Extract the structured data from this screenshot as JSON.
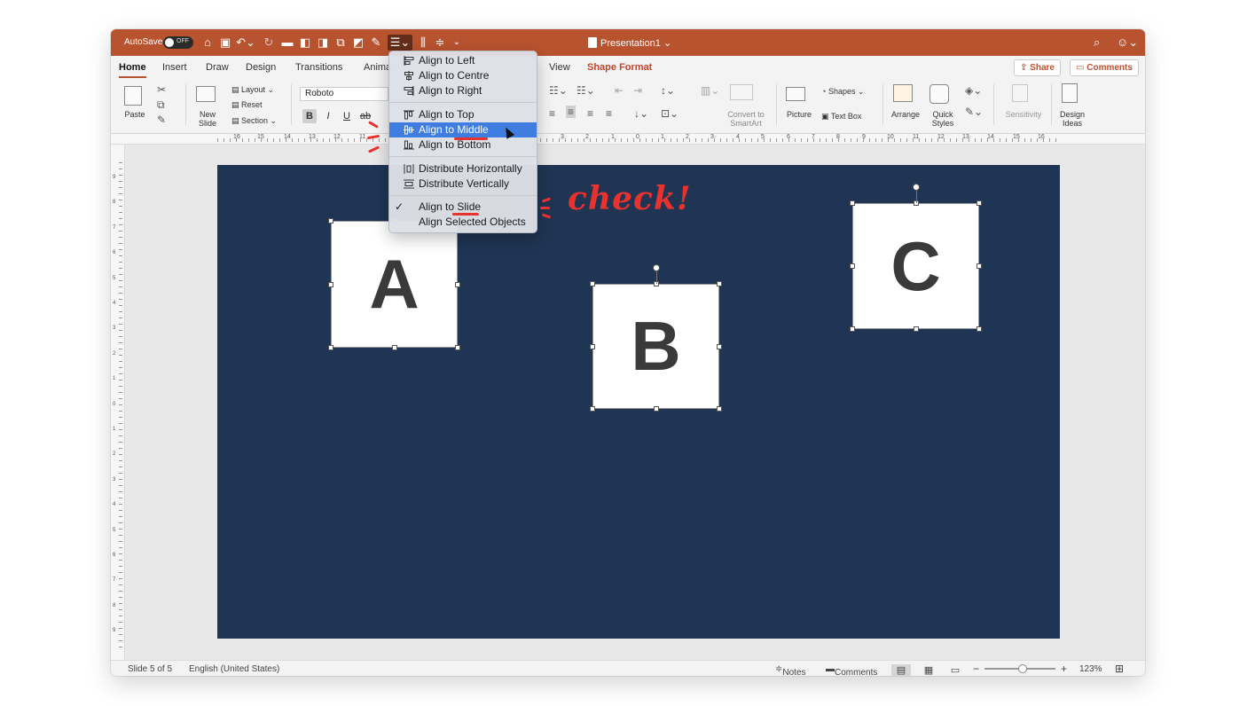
{
  "titlebar": {
    "autosave": "AutoSave",
    "toggle": "OFF",
    "doc_title": "Presentation1",
    "icons": [
      "home-icon",
      "save-icon",
      "undo-icon",
      "redo-icon",
      "align-icon",
      "distribute-icon",
      "search-icon",
      "smiley-icon"
    ]
  },
  "tabs": [
    "Home",
    "Insert",
    "Draw",
    "Design",
    "Transitions",
    "Anima",
    "View",
    "Shape Format"
  ],
  "share": "Share",
  "comments_btn": "Comments",
  "ribbon": {
    "paste": "Paste",
    "new_slide": [
      "New",
      "Slide"
    ],
    "layout": "Layout",
    "reset": "Reset",
    "section": "Section",
    "font": "Roboto",
    "bold": "B",
    "italic": "I",
    "underline": "U",
    "strike": "ab",
    "convert": [
      "Convert to",
      "SmartArt"
    ],
    "picture": "Picture",
    "shapes": "Shapes",
    "text_box": "Text Box",
    "arrange": "Arrange",
    "quick_styles": [
      "Quick",
      "Styles"
    ],
    "sensitivity": "Sensitivity",
    "design_ideas": [
      "Design",
      "Ideas"
    ]
  },
  "menu": {
    "items": [
      {
        "label": "Align to Left",
        "icon": "align-left-icon"
      },
      {
        "label": "Align to Centre",
        "icon": "align-centre-icon"
      },
      {
        "label": "Align to Right",
        "icon": "align-right-icon"
      },
      {
        "label": "Align to Top",
        "icon": "align-top-icon"
      },
      {
        "label": "Align to Middle",
        "icon": "align-middle-icon",
        "highlighted": true
      },
      {
        "label": "Align to Bottom",
        "icon": "align-bottom-icon"
      },
      {
        "label": "Distribute Horizontally",
        "icon": "distribute-horizontally-icon"
      },
      {
        "label": "Distribute Vertically",
        "icon": "distribute-vertically-icon"
      },
      {
        "label": "Align to Slide",
        "checked": true
      },
      {
        "label": "Align Selected Objects"
      }
    ]
  },
  "annotation": "check!",
  "slide": {
    "background": "#1f3553",
    "shapes": [
      "A",
      "B",
      "C"
    ]
  },
  "status": {
    "slide": "Slide 5 of 5",
    "language": "English (United States)",
    "notes": "Notes",
    "comments": "Comments",
    "zoom_minus": "−",
    "zoom_plus": "+",
    "zoom": "123%"
  },
  "ruler": {
    "h": [
      "16",
      "15",
      "14",
      "13",
      "12",
      "11",
      "3",
      "2",
      "1",
      "0",
      "1",
      "2",
      "3",
      "4",
      "5",
      "6",
      "7",
      "8",
      "9",
      "10",
      "11",
      "12",
      "13",
      "14",
      "15",
      "16"
    ],
    "v": [
      "9",
      "8",
      "7",
      "6",
      "5",
      "4",
      "3",
      "2",
      "1",
      "0",
      "1",
      "2",
      "3",
      "4",
      "5",
      "6",
      "7",
      "8",
      "9"
    ]
  },
  "colors": {
    "brand": "#b8532f",
    "highlight": "#3f7de0",
    "annotation": "#e8322e"
  }
}
